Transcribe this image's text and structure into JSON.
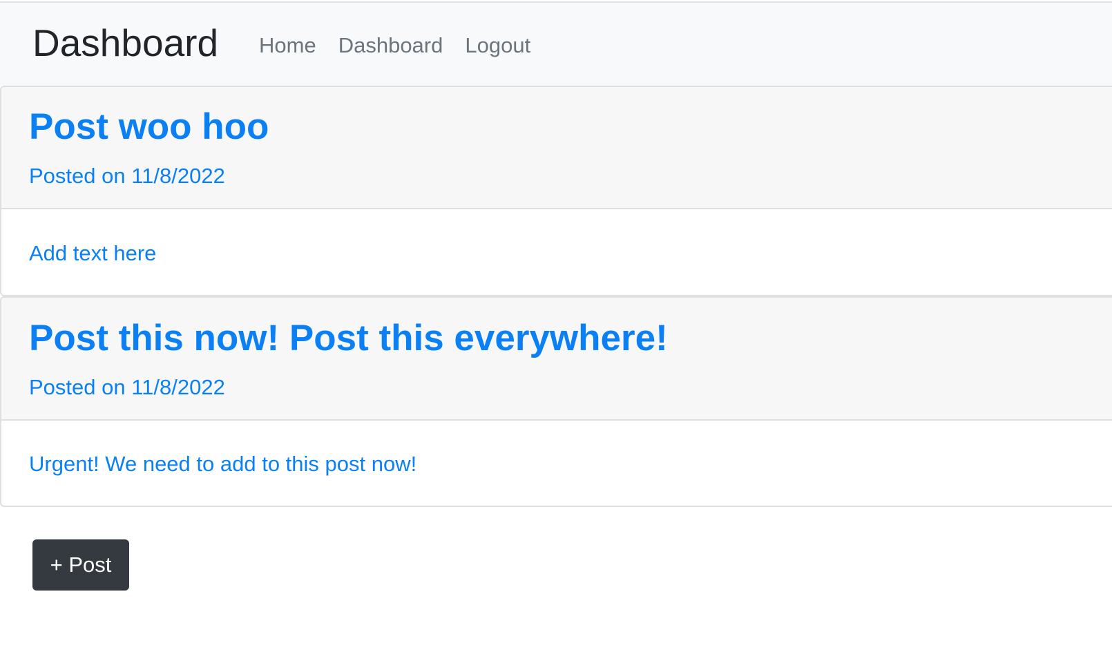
{
  "navbar": {
    "brand": "Dashboard",
    "links": [
      {
        "label": "Home"
      },
      {
        "label": "Dashboard"
      },
      {
        "label": "Logout"
      }
    ]
  },
  "posts": [
    {
      "title": "Post woo hoo",
      "date_text": "Posted on 11/8/2022",
      "body": "Add text here"
    },
    {
      "title": "Post this now! Post this everywhere!",
      "date_text": "Posted on 11/8/2022",
      "body": "Urgent! We need to add to this post now!"
    }
  ],
  "actions": {
    "new_post_label": "+ Post"
  },
  "colors": {
    "link_blue": "#0b80f5",
    "navbar_bg": "#f8f9fa",
    "card_header_bg": "#f7f7f7",
    "button_dark": "#343a40"
  }
}
